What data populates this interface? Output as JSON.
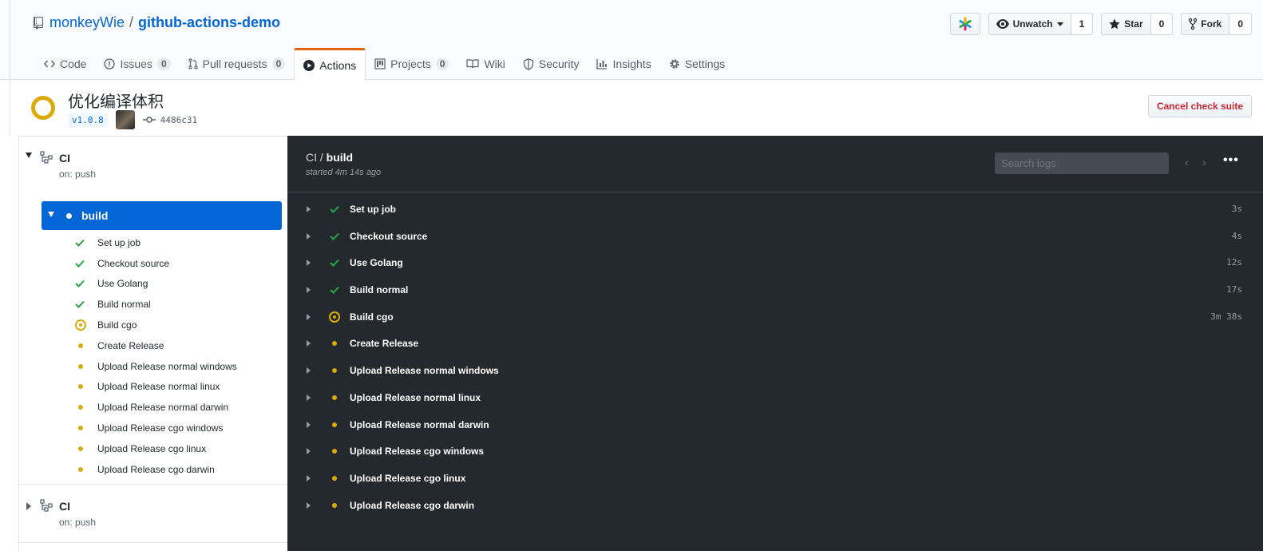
{
  "repo": {
    "owner": "monkeyWie",
    "separator": "/",
    "name": "github-actions-demo"
  },
  "header_buttons": {
    "unwatch_label": "Unwatch",
    "unwatch_count": "1",
    "star_label": "Star",
    "star_count": "0",
    "fork_label": "Fork",
    "fork_count": "0"
  },
  "tabs": [
    {
      "label": "Code",
      "icon": "code-icon",
      "count": null
    },
    {
      "label": "Issues",
      "icon": "issue-icon",
      "count": "0"
    },
    {
      "label": "Pull requests",
      "icon": "pull-request-icon",
      "count": "0"
    },
    {
      "label": "Actions",
      "icon": "play-icon",
      "count": null,
      "selected": true
    },
    {
      "label": "Projects",
      "icon": "project-icon",
      "count": "0"
    },
    {
      "label": "Wiki",
      "icon": "book-icon",
      "count": null
    },
    {
      "label": "Security",
      "icon": "shield-icon",
      "count": null
    },
    {
      "label": "Insights",
      "icon": "graph-icon",
      "count": null
    },
    {
      "label": "Settings",
      "icon": "gear-icon",
      "count": null
    }
  ],
  "suite": {
    "title": "优化编译体积",
    "tag": "v1.0.8",
    "commit_sha": "4486c31",
    "cancel_label": "Cancel check suite",
    "status_color": "#dbab09"
  },
  "sidebar": {
    "workflows": [
      {
        "name": "CI",
        "trigger": "on: push",
        "expanded": true
      },
      {
        "name": "CI",
        "trigger": "on: push",
        "expanded": false
      }
    ],
    "job": {
      "name": "build"
    }
  },
  "steps": [
    {
      "name": "Set up job",
      "status": "success",
      "duration": "3s"
    },
    {
      "name": "Checkout source",
      "status": "success",
      "duration": "4s"
    },
    {
      "name": "Use Golang",
      "status": "success",
      "duration": "12s"
    },
    {
      "name": "Build normal",
      "status": "success",
      "duration": "17s"
    },
    {
      "name": "Build cgo",
      "status": "in_progress",
      "duration": "3m 38s"
    },
    {
      "name": "Create Release",
      "status": "queued",
      "duration": ""
    },
    {
      "name": "Upload Release normal windows",
      "status": "queued",
      "duration": ""
    },
    {
      "name": "Upload Release normal linux",
      "status": "queued",
      "duration": ""
    },
    {
      "name": "Upload Release normal darwin",
      "status": "queued",
      "duration": ""
    },
    {
      "name": "Upload Release cgo windows",
      "status": "queued",
      "duration": ""
    },
    {
      "name": "Upload Release cgo linux",
      "status": "queued",
      "duration": ""
    },
    {
      "name": "Upload Release cgo darwin",
      "status": "queued",
      "duration": ""
    }
  ],
  "log": {
    "workflow": "CI",
    "separator": " / ",
    "job": "build",
    "started": "started 4m 14s ago",
    "search_placeholder": "Search logs"
  },
  "colors": {
    "success": "#28a745",
    "pending": "#dbab09",
    "accent": "#0366d6",
    "tab_active": "#e36209"
  }
}
